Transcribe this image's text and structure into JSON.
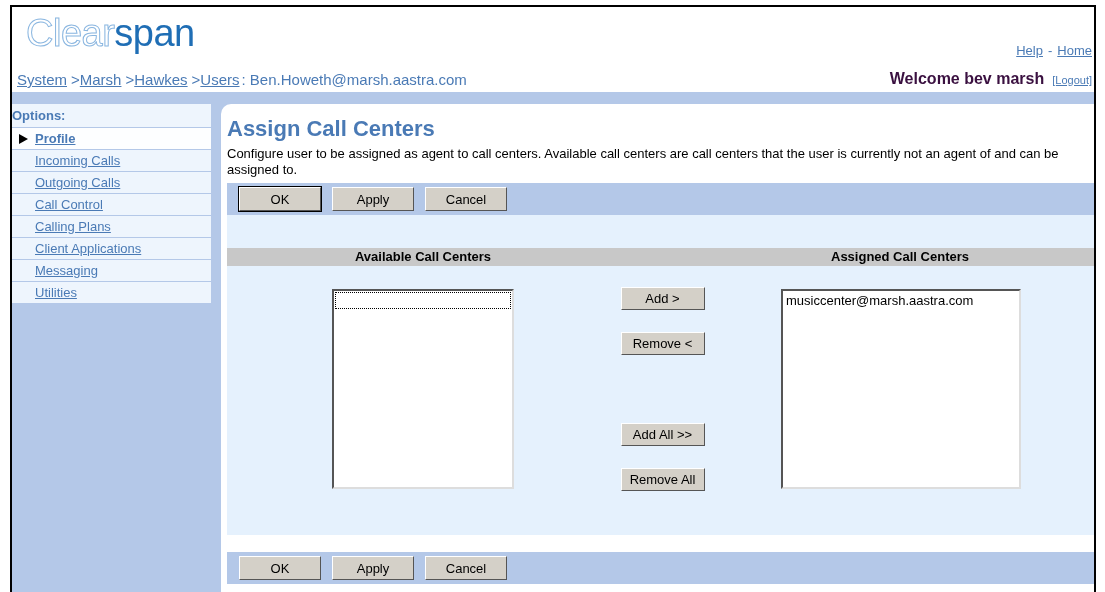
{
  "header": {
    "logo": {
      "outline": "Clear",
      "solid": "span"
    },
    "links": [
      {
        "kind": "link",
        "text": "Help"
      },
      {
        "kind": "separator",
        "text": "-"
      },
      {
        "kind": "link",
        "text": "Home"
      }
    ],
    "breadcrumb": [
      {
        "kind": "link",
        "text": "System"
      },
      {
        "kind": "separator",
        "text": ">"
      },
      {
        "kind": "link",
        "text": "Marsh"
      },
      {
        "kind": "separator",
        "text": ">"
      },
      {
        "kind": "link",
        "text": "Hawkes"
      },
      {
        "kind": "separator",
        "text": ">"
      },
      {
        "kind": "link",
        "text": "Users"
      },
      {
        "kind": "text",
        "text": ": Ben.Howeth@marsh.aastra.com"
      }
    ],
    "welcome": "Welcome bev marsh",
    "logout": "[Logout]"
  },
  "sidebar": {
    "heading": "Options:",
    "items": [
      {
        "label": "Profile",
        "selected": true
      },
      {
        "label": "Incoming Calls",
        "selected": false
      },
      {
        "label": "Outgoing Calls",
        "selected": false
      },
      {
        "label": "Call Control",
        "selected": false
      },
      {
        "label": "Calling Plans",
        "selected": false
      },
      {
        "label": "Client Applications",
        "selected": false
      },
      {
        "label": "Messaging",
        "selected": false
      },
      {
        "label": "Utilities",
        "selected": false
      }
    ]
  },
  "main": {
    "title": "Assign Call Centers",
    "description": "Configure user to be assigned as agent to call centers. Available call centers are call centers that the user is currently not an agent of and can be assigned to.",
    "top_buttons": [
      {
        "label": "OK",
        "default": true
      },
      {
        "label": "Apply",
        "default": false
      },
      {
        "label": "Cancel",
        "default": false
      }
    ],
    "available_heading": "Available Call Centers",
    "assigned_heading": "Assigned Call Centers",
    "move_buttons": [
      "Add >",
      "Remove <",
      "Add All >>",
      "Remove All"
    ],
    "assigned_items": [
      "musiccenter@marsh.aastra.com"
    ],
    "bottom_buttons": [
      {
        "label": "OK",
        "default": false
      },
      {
        "label": "Apply",
        "default": false
      },
      {
        "label": "Cancel",
        "default": false
      }
    ]
  }
}
